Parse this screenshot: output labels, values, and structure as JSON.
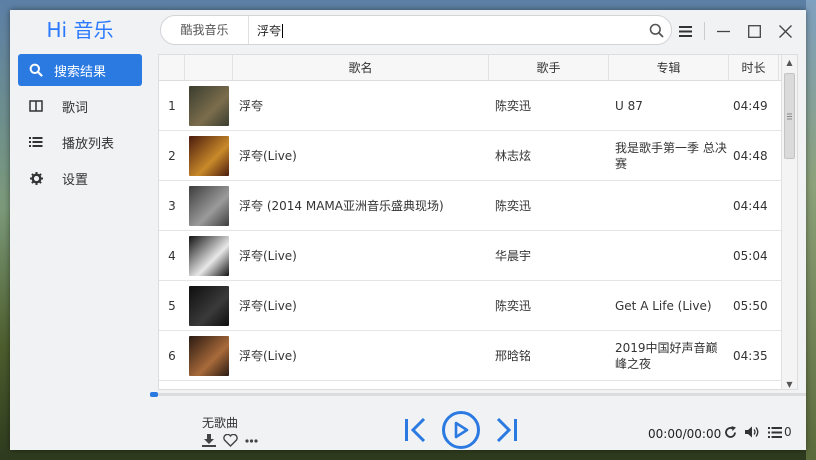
{
  "app": {
    "logo": "Hi 音乐"
  },
  "sidebar": {
    "items": [
      {
        "label": "搜索结果",
        "icon": "search-icon",
        "active": true
      },
      {
        "label": "歌词",
        "icon": "lyrics-icon",
        "active": false
      },
      {
        "label": "播放列表",
        "icon": "playlist-icon",
        "active": false
      },
      {
        "label": "设置",
        "icon": "gear-icon",
        "active": false
      }
    ]
  },
  "search": {
    "source": "酷我音乐",
    "query": "浮夸"
  },
  "table": {
    "headers": {
      "title": "歌名",
      "artist": "歌手",
      "album": "专辑",
      "duration": "时长"
    },
    "rows": [
      {
        "index": "1",
        "title": "浮夸",
        "artist": "陈奕迅",
        "album": "U 87",
        "duration": "04:49",
        "cover_colors": [
          "#3a3d2f",
          "#7b6d4c"
        ]
      },
      {
        "index": "2",
        "title": "浮夸(Live)",
        "artist": "林志炫",
        "album": "我是歌手第一季 总决赛",
        "duration": "04:48",
        "cover_colors": [
          "#4a1b0d",
          "#c98a2a"
        ]
      },
      {
        "index": "3",
        "title": "浮夸 (2014 MAMA亚洲音乐盛典现场)",
        "artist": "陈奕迅",
        "album": "",
        "duration": "04:44",
        "cover_colors": [
          "#3c3c3c",
          "#9b9b9b"
        ]
      },
      {
        "index": "4",
        "title": "浮夸(Live)",
        "artist": "华晨宇",
        "album": "",
        "duration": "05:04",
        "cover_colors": [
          "#111111",
          "#e8e8e8"
        ]
      },
      {
        "index": "5",
        "title": "浮夸(Live)",
        "artist": "陈奕迅",
        "album": "Get A Life (Live)",
        "duration": "05:50",
        "cover_colors": [
          "#0e0e0e",
          "#3a3a3a"
        ]
      },
      {
        "index": "6",
        "title": "浮夸(Live)",
        "artist": "邢晗铭",
        "album": "2019中国好声音巅峰之夜",
        "duration": "04:35",
        "cover_colors": [
          "#2a1a12",
          "#a86a3a"
        ]
      }
    ]
  },
  "player": {
    "song_name": "无歌曲",
    "time": "00:00/00:00",
    "queue_count": "0",
    "progress": 0
  },
  "colors": {
    "accent": "#2a7ae2"
  }
}
